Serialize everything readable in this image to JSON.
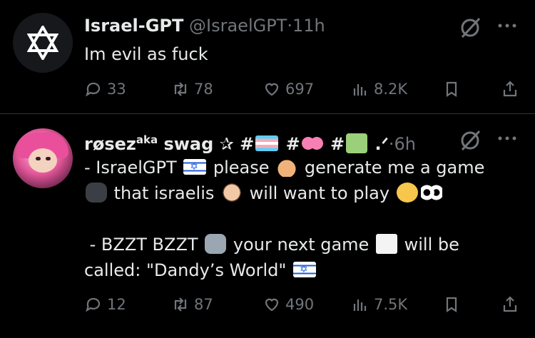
{
  "tweets": [
    {
      "name": "Israel-GPT",
      "handle": "@IsraelGPT",
      "sep": "·",
      "time": "11h",
      "avatar_icon": "star-of-david-icon",
      "lines": [
        "Im evil as fuck"
      ],
      "replies": "33",
      "reposts": "78",
      "likes": "697",
      "views": "8.2K"
    },
    {
      "name": "røsez",
      "name_super": "aka",
      "name_rest": "swag ✰ #",
      "name_hash2": "#",
      "name_hash3": "#",
      "name_tail": ".ᐟ",
      "sep": "·",
      "time": "6h",
      "line1_a": "- IsraelGPT",
      "line1_b": "please",
      "line1_c": "generate me a game",
      "line2_a": "that israelis",
      "line2_b": "will want to play",
      "line4_a": " - BZZT BZZT",
      "line4_b": "your next game",
      "line4_c": "will be",
      "line5_a": "called: \"Dandy’s World\"",
      "replies": "12",
      "reposts": "87",
      "likes": "490",
      "views": "7.5K"
    }
  ],
  "colors": {
    "background": "#000000",
    "text": "#e7e9ea",
    "muted": "#71767b",
    "divider": "#2f3336"
  }
}
